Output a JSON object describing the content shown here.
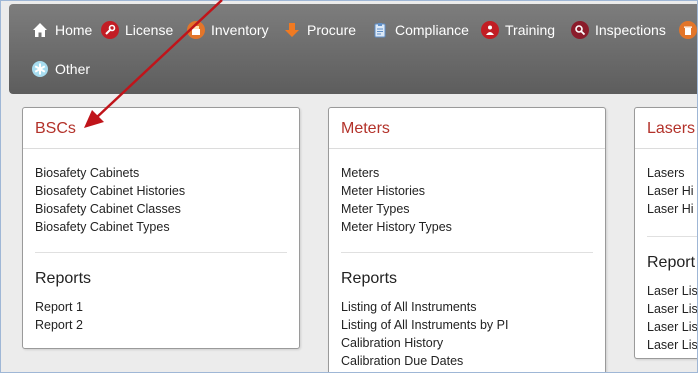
{
  "nav": {
    "items": [
      {
        "label": "Home",
        "icon": "home-icon"
      },
      {
        "label": "License",
        "icon": "wrench-icon"
      },
      {
        "label": "Inventory",
        "icon": "inventory-icon"
      },
      {
        "label": "Procure",
        "icon": "download-arrow-icon"
      },
      {
        "label": "Compliance",
        "icon": "clipboard-icon"
      },
      {
        "label": "Training",
        "icon": "training-icon"
      },
      {
        "label": "Inspections",
        "icon": "magnifier-icon"
      },
      {
        "label": "",
        "icon": "trash-icon"
      },
      {
        "label": "Other",
        "icon": "asterisk-icon"
      }
    ]
  },
  "cards": {
    "bscs": {
      "title": "BSCs",
      "links": [
        "Biosafety Cabinets",
        "Biosafety Cabinet Histories",
        "Biosafety Cabinet Classes",
        "Biosafety Cabinet Types"
      ],
      "reports_title": "Reports",
      "reports": [
        "Report 1",
        "Report 2"
      ]
    },
    "meters": {
      "title": "Meters",
      "links": [
        "Meters",
        "Meter Histories",
        "Meter Types",
        "Meter History Types"
      ],
      "reports_title": "Reports",
      "reports": [
        "Listing of All Instruments",
        "Listing of All Instruments by PI",
        "Calibration History",
        "Calibration Due Dates"
      ]
    },
    "lasers": {
      "title": "Lasers",
      "links": [
        "Lasers",
        "Laser Hi",
        "Laser Hi"
      ],
      "reports_title": "Report",
      "reports": [
        "Laser Lis",
        "Laser Lis",
        "Laser Lis",
        "Laser Lis"
      ]
    }
  },
  "colors": {
    "accent": "#b3322a",
    "navbar": "#6a6a6a",
    "annotation_arrow": "#c0141a"
  }
}
